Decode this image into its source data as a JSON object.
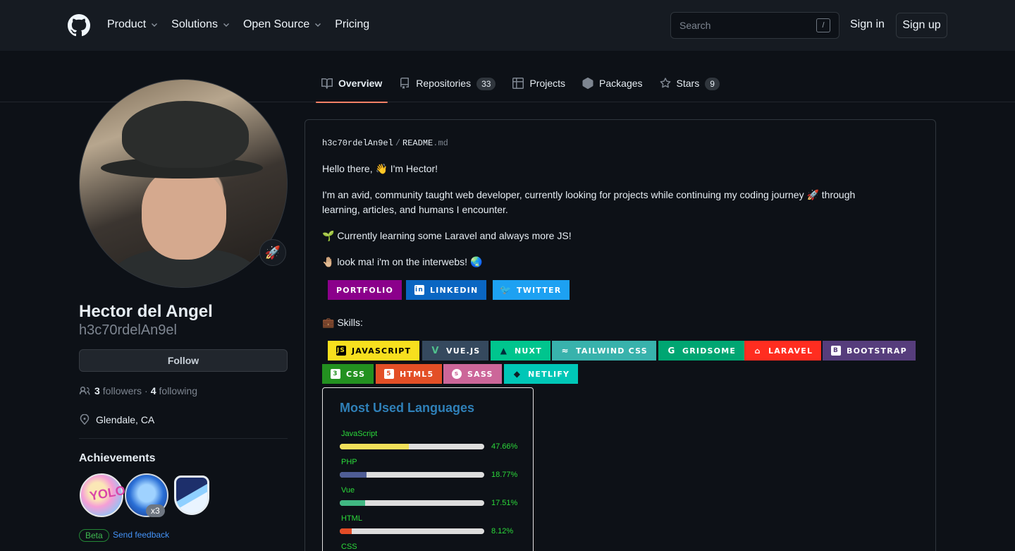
{
  "header": {
    "logo_icon": "github-mark-icon",
    "nav": [
      "Product",
      "Solutions",
      "Open Source",
      "Pricing"
    ],
    "search_placeholder": "Search",
    "search_shortcut": "/",
    "signin": "Sign in",
    "signup": "Sign up"
  },
  "tabs": [
    {
      "label": "Overview",
      "icon": "book-icon",
      "active": true
    },
    {
      "label": "Repositories",
      "icon": "repo-icon",
      "count": "33"
    },
    {
      "label": "Projects",
      "icon": "table-icon"
    },
    {
      "label": "Packages",
      "icon": "package-icon"
    },
    {
      "label": "Stars",
      "icon": "star-icon",
      "count": "9"
    }
  ],
  "profile": {
    "status_emoji": "🚀",
    "full_name": "Hector del Angel",
    "username": "h3c70rdelAn9el",
    "follow": "Follow",
    "followers_count": "3",
    "followers_label": "followers",
    "following_count": "4",
    "following_label": "following",
    "location": "Glendale, CA",
    "achievements_title": "Achievements",
    "achievement_multiplier": "x3",
    "beta": "Beta",
    "feedback": "Send feedback"
  },
  "readme": {
    "owner": "h3c70rdelAn9el",
    "separator": "/",
    "file": "README",
    "ext": ".md",
    "greeting": "Hello there, 👋  I'm Hector!",
    "intro_1": "I'm an avid, community taught web developer, currently looking for projects while continuing my coding journey 🚀 through",
    "intro_2": "learning, articles, and humans I encounter.",
    "learning": "🌱 Currently learning some Laravel and always more JS!",
    "interwebs": "🤚🏼 look ma! i'm on the interwebs! 🌏",
    "skills": "💼 Skills:",
    "links": [
      {
        "label": "PORTFOLIO",
        "color": "#8b008b"
      },
      {
        "label": "LINKEDIN",
        "color": "#0a66c2"
      },
      {
        "label": "TWITTER",
        "color": "#1da1f2"
      }
    ],
    "skill_badges": [
      {
        "label": "JAVASCRIPT",
        "color": "#f7df1e",
        "text": "#000000"
      },
      {
        "label": "VUE.JS",
        "color": "#35495e",
        "text": "#4fc08d"
      },
      {
        "label": "NUXT",
        "color": "#00c58e",
        "text": "#ffffff"
      },
      {
        "label": "TAILWIND CSS",
        "color": "#38b2ac",
        "text": "#ffffff"
      },
      {
        "label": "GRIDSOME",
        "color": "#00a672",
        "text": "#ffffff"
      },
      {
        "label": "LARAVEL",
        "color": "#ff2d20",
        "text": "#ffffff"
      },
      {
        "label": "BOOTSTRAP",
        "color": "#563d7c",
        "text": "#ffffff"
      },
      {
        "label": "CSS",
        "color": "#239120",
        "text": "#ffffff"
      },
      {
        "label": "HTML5",
        "color": "#e34f26",
        "text": "#ffffff"
      },
      {
        "label": "SASS",
        "color": "#cc6699",
        "text": "#ffffff"
      },
      {
        "label": "NETLIFY",
        "color": "#00c7b7",
        "text": "#ffffff"
      }
    ]
  },
  "languages": {
    "title": "Most Used Languages",
    "items": [
      {
        "name": "JavaScript",
        "percent": "47.66%",
        "value": 47.66,
        "color": "#f1e05a"
      },
      {
        "name": "PHP",
        "percent": "18.77%",
        "value": 18.77,
        "color": "#4f5d95"
      },
      {
        "name": "Vue",
        "percent": "17.51%",
        "value": 17.51,
        "color": "#41b883"
      },
      {
        "name": "HTML",
        "percent": "8.12%",
        "value": 8.12,
        "color": "#e34c26"
      },
      {
        "name": "CSS",
        "percent": "",
        "value": null,
        "color": "#563d7c"
      }
    ]
  }
}
